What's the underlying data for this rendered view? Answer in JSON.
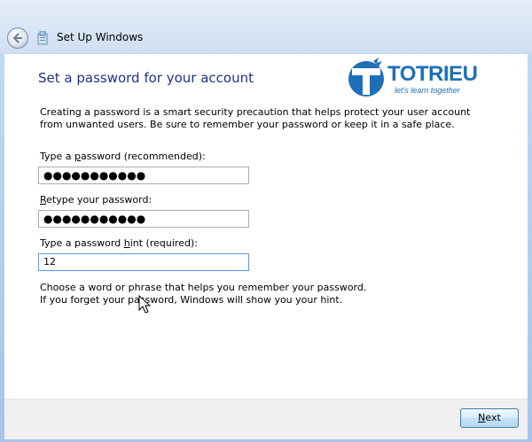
{
  "titlebar": {
    "title": "Set Up Windows",
    "back_icon": "back-arrow-icon",
    "app_icon": "setup-icon"
  },
  "heading": "Set a password for your account",
  "intro": "Creating a password is a smart security precaution that helps protect your user account from unwanted users. Be sure to remember your password or keep it in a safe place.",
  "logo": {
    "text": "TOTRIEU",
    "tagline": "let's learn together",
    "color": "#1f6fb8"
  },
  "password": {
    "label_pre": "Type a ",
    "label_accel": "p",
    "label_post": "assword (recommended):",
    "value": "●●●●●●●●●●●"
  },
  "retype": {
    "label_accel": "R",
    "label_post": "etype your password:",
    "value": "●●●●●●●●●●●"
  },
  "hint": {
    "label_pre": "Type a password ",
    "label_accel": "h",
    "label_post": "int (required):",
    "value": "12"
  },
  "help": {
    "line1": "Choose a word or phrase that helps you remember your password.",
    "line2": "If you forget your password, Windows will show you your hint."
  },
  "footer": {
    "next_accel": "N",
    "next_post": "ext"
  },
  "colors": {
    "heading": "#1e3287",
    "accent_border": "#569de5"
  }
}
